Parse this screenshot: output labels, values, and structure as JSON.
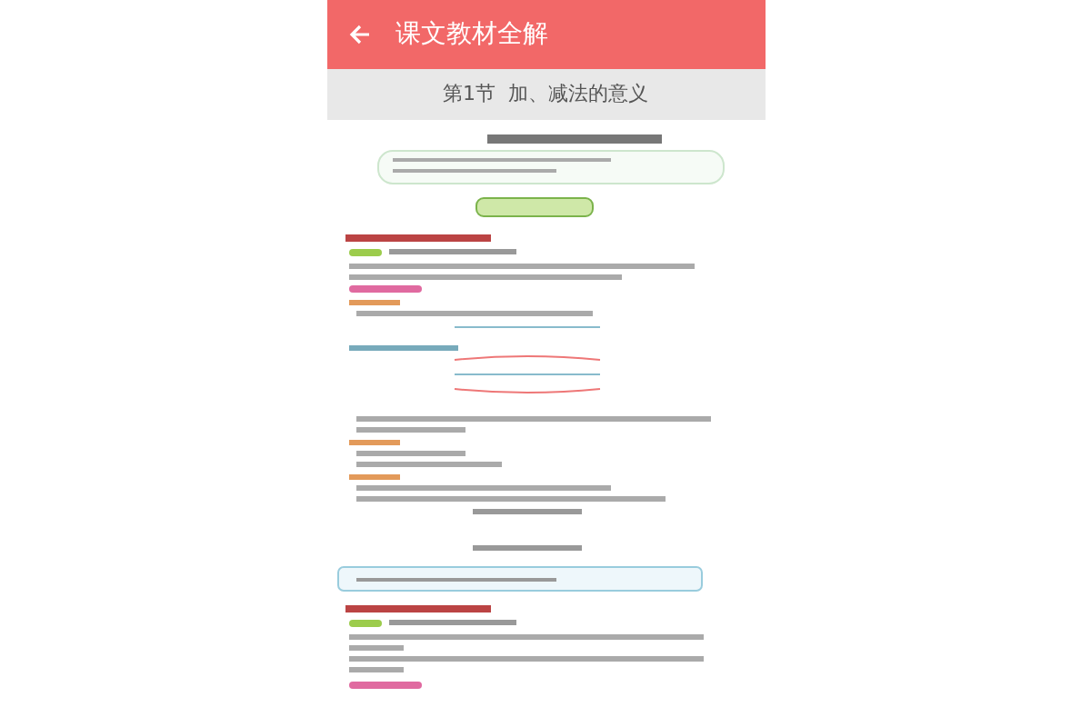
{
  "header": {
    "title": "课文教材全解"
  },
  "section_bar": {
    "title": "第1节  加、减法的意义"
  }
}
